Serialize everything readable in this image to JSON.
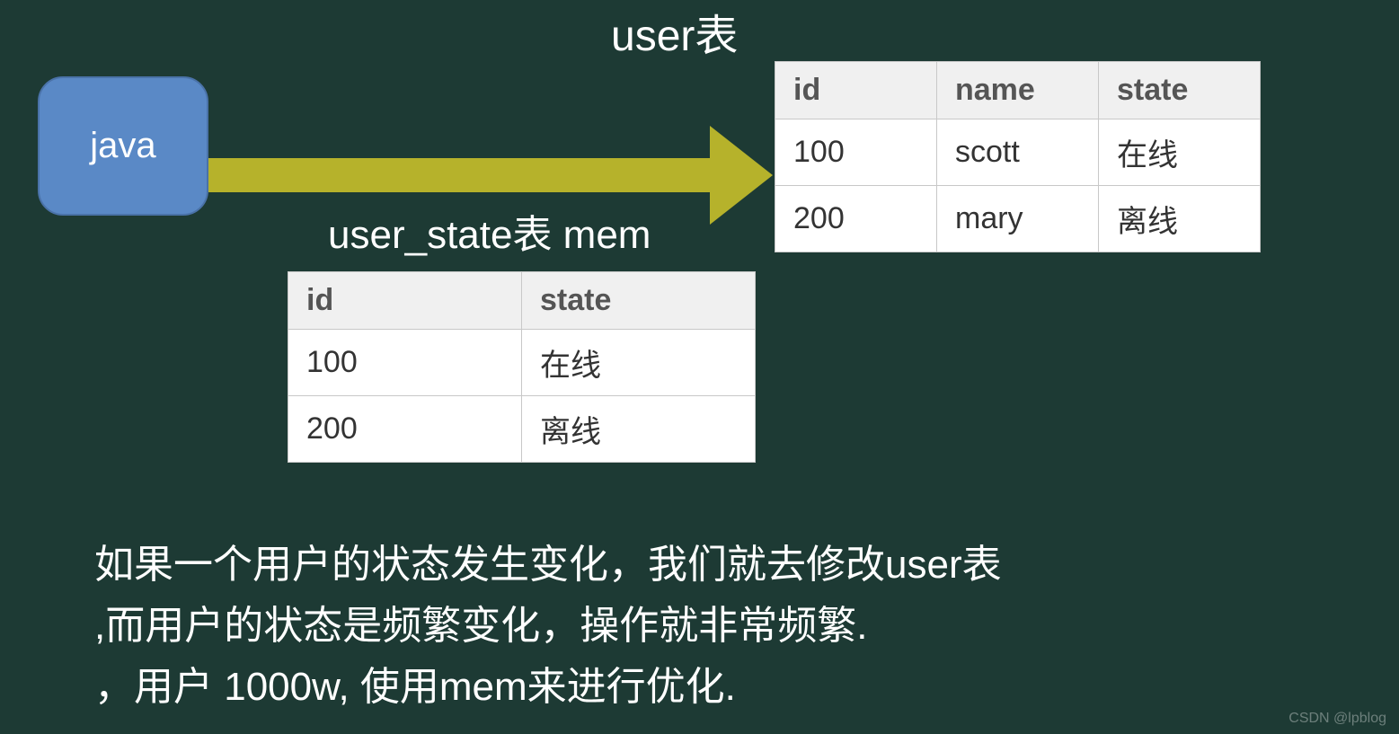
{
  "java_box": {
    "label": "java"
  },
  "titles": {
    "user_table": "user表",
    "user_state_table": "user_state表 mem"
  },
  "user_table": {
    "headers": [
      "id",
      "name",
      "state"
    ],
    "rows": [
      [
        "100",
        "scott",
        "在线"
      ],
      [
        "200",
        "mary",
        "离线"
      ]
    ]
  },
  "user_state_table": {
    "headers": [
      "id",
      "state"
    ],
    "rows": [
      [
        "100",
        "在线"
      ],
      [
        "200",
        "离线"
      ]
    ]
  },
  "body_text": {
    "line1": "如果一个用户的状态发生变化，我们就去修改user表",
    "line2": ",而用户的状态是频繁变化，操作就非常频繁.",
    "line3": "，用户 1000w, 使用mem来进行优化."
  },
  "watermark": "CSDN @lpblog"
}
